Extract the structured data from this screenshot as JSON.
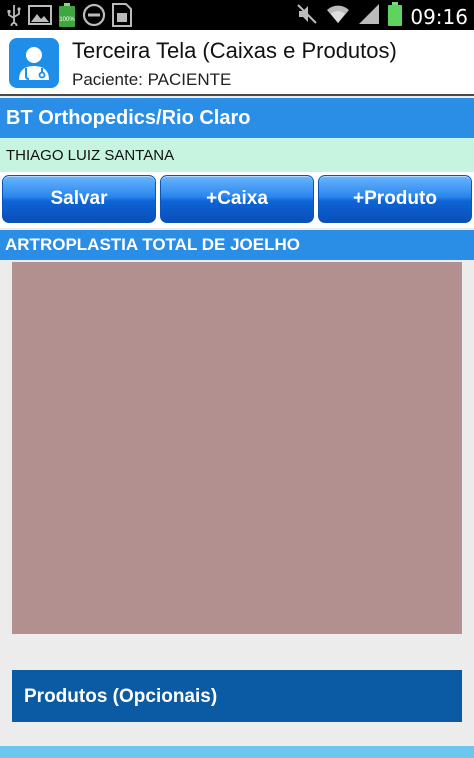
{
  "status_bar": {
    "time": "09:16",
    "battery_label": "100%",
    "icons": [
      "usb-icon",
      "image-icon",
      "battery-full-icon",
      "do-not-disturb-icon",
      "sim-card-icon",
      "mute-icon",
      "wifi-icon",
      "signal-icon",
      "battery-icon"
    ]
  },
  "action_bar": {
    "title": "Terceira Tela (Caixas e Produtos)",
    "subtitle": "Paciente: PACIENTE"
  },
  "clinic": {
    "name": "BT Orthopedics/Rio Claro"
  },
  "patient": {
    "name": "THIAGO LUIZ SANTANA"
  },
  "buttons": {
    "salvar": "Salvar",
    "caixa": "+Caixa",
    "produto": "+Produto"
  },
  "procedure": {
    "name": "ARTROPLASTIA TOTAL DE JOELHO"
  },
  "produtos": {
    "label": "Produtos (Opcionais)"
  },
  "colors": {
    "header_blue": "#2a8ee6",
    "patient_green": "#c6f4e1",
    "box_panel": "#b29090",
    "produtos_blue": "#0b5aa4"
  }
}
